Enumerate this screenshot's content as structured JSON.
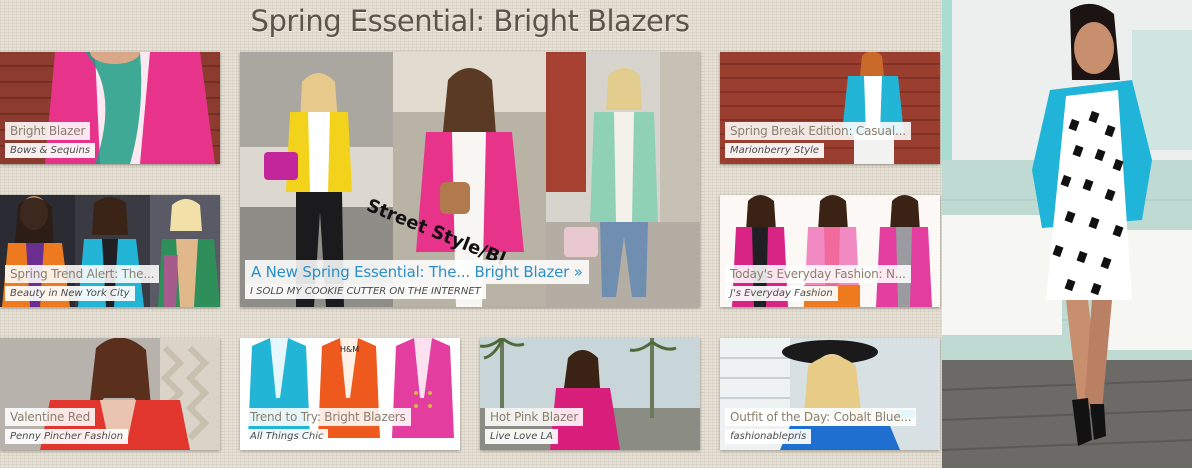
{
  "page": {
    "title": "Spring Essential: Bright Blazers"
  },
  "tiles": [
    {
      "title": "Bright Blazer",
      "source": "Bows & Sequins"
    },
    {
      "title": "Spring Trend Alert: The...",
      "source": "Beauty in New York City"
    },
    {
      "title": "Valentine Red",
      "source": "Penny Pincher Fashion"
    },
    {
      "title": "A New Spring Essential: The... Bright Blazer »",
      "source": "I SOLD MY COOKIE CUTTER ON THE INTERNET",
      "overlay": "Street Style/Bl"
    },
    {
      "title": "Trend to Try: Bright Blazers",
      "source": "All Things Chic"
    },
    {
      "title": "Hot Pink Blazer",
      "source": "Live Love LA"
    },
    {
      "title": "Spring Break Edition: Casual...",
      "source": "Marionberry Style"
    },
    {
      "title": "Today's Everyday Fashion: N...",
      "source": "J's Everyday Fashion"
    },
    {
      "title": "Outfit of the Day: Cobalt Blue...",
      "source": "fashionablepris"
    }
  ],
  "colors": {
    "caption_title": "#8a7e6c",
    "caption_title_featured": "#2a8fc9",
    "pink_blazer": "#e8338a",
    "cyan_blazer": "#22b5d6",
    "yellow_blazer": "#f2d21b",
    "mint_blazer": "#8fd1b4",
    "red_blazer": "#e0362e",
    "orange_blazer": "#ee5a1d"
  }
}
